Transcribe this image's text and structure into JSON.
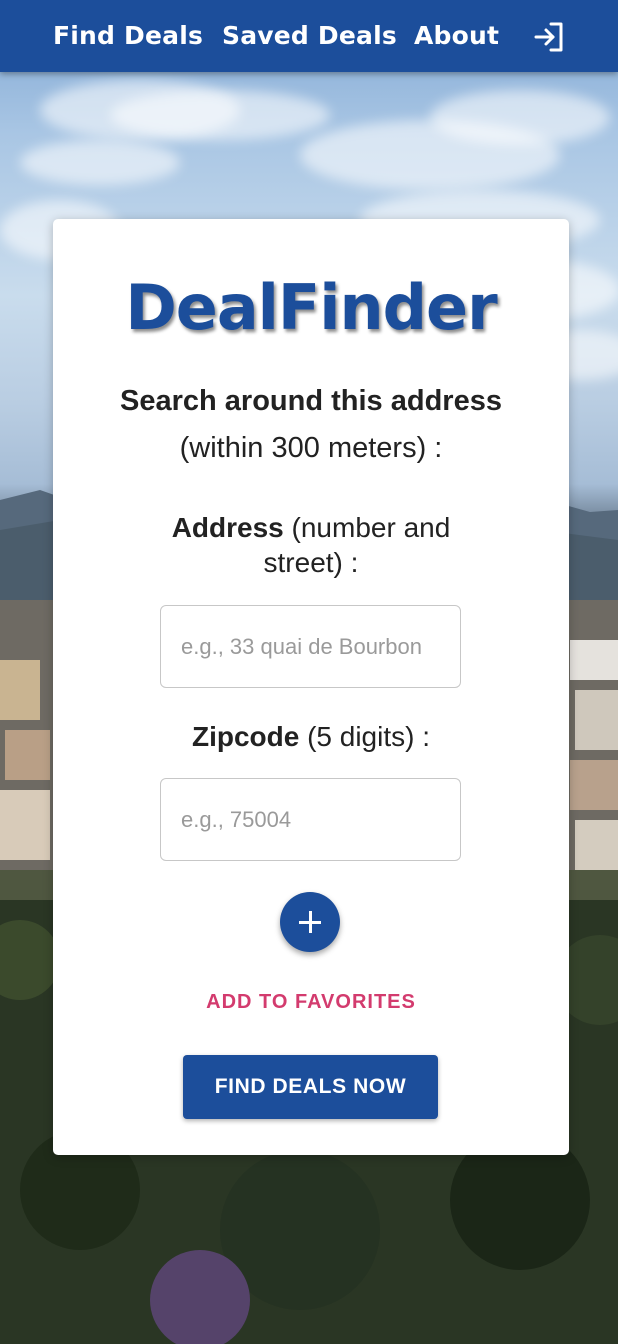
{
  "nav": {
    "find_deals": "Find Deals",
    "saved_deals": "Saved Deals",
    "about": "About",
    "login_icon": "login-icon"
  },
  "card": {
    "logo": "DealFinder",
    "heading": "Search around this address",
    "subheading": "(within 300 meters) :",
    "address_label_bold": "Address",
    "address_label_rest": " (number and street) :",
    "address_placeholder": "e.g., 33 quai de Bourbon",
    "address_value": "",
    "zip_label_bold": "Zipcode",
    "zip_label_rest": " (5 digits) :",
    "zip_placeholder": "e.g., 75004",
    "zip_value": "",
    "add_icon": "plus-icon",
    "add_to_favorites": "ADD TO FAVORITES",
    "find_button": "FIND DEALS NOW"
  },
  "colors": {
    "brand": "#1c4e9b",
    "favorites_link": "#d33b6e"
  }
}
